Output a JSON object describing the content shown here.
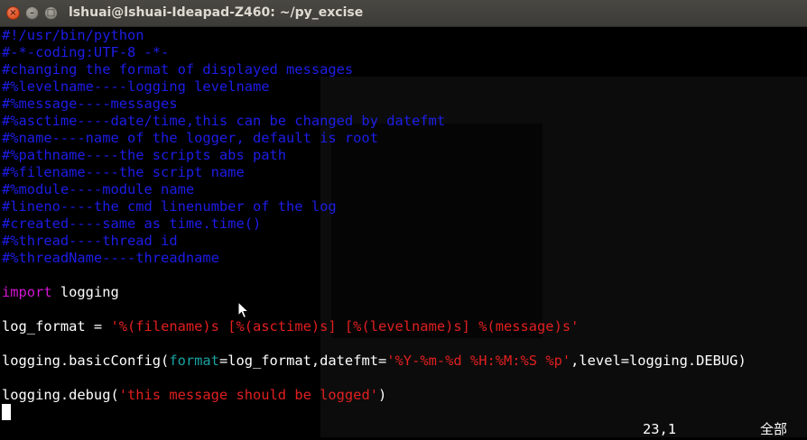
{
  "window": {
    "title": "lshuai@lshuai-Ideapad-Z460: ~/py_excise",
    "buttons": {
      "close": "×",
      "minimize": "–",
      "maximize": "□"
    }
  },
  "editor": {
    "lines": [
      [
        {
          "t": "#!/usr/bin/python",
          "c": "comment"
        }
      ],
      [
        {
          "t": "#-*-coding:UTF-8 -*-",
          "c": "comment"
        }
      ],
      [
        {
          "t": "#changing the format of displayed messages",
          "c": "comment"
        }
      ],
      [
        {
          "t": "#%levelname----logging levelname",
          "c": "comment"
        }
      ],
      [
        {
          "t": "#%message----messages",
          "c": "comment"
        }
      ],
      [
        {
          "t": "#%asctime----date/time,this can be changed by datefmt",
          "c": "comment"
        }
      ],
      [
        {
          "t": "#%name----name of the logger, default is root",
          "c": "comment"
        }
      ],
      [
        {
          "t": "#%pathname----the scripts abs path",
          "c": "comment"
        }
      ],
      [
        {
          "t": "#%filename----the script name",
          "c": "comment"
        }
      ],
      [
        {
          "t": "#%module----module name",
          "c": "comment"
        }
      ],
      [
        {
          "t": "#lineno----the cmd linenumber of the log",
          "c": "comment"
        }
      ],
      [
        {
          "t": "#created----same as time.time()",
          "c": "comment"
        }
      ],
      [
        {
          "t": "#%thread----thread id",
          "c": "comment"
        }
      ],
      [
        {
          "t": "#%threadName----threadname",
          "c": "comment"
        }
      ],
      [],
      [
        {
          "t": "import",
          "c": "kw"
        },
        {
          "t": " logging",
          "c": "plain"
        }
      ],
      [],
      [
        {
          "t": "log_format = ",
          "c": "plain"
        },
        {
          "t": "'%(filename)s [%(asctime)s] [%(levelname)s] %(message)s'",
          "c": "str"
        }
      ],
      [],
      [
        {
          "t": "logging.basicConfig(",
          "c": "plain"
        },
        {
          "t": "format",
          "c": "kwarg"
        },
        {
          "t": "=log_format,datefmt=",
          "c": "plain"
        },
        {
          "t": "'%Y-%m-%d %H:%M:%S %p'",
          "c": "str"
        },
        {
          "t": ",level=logging.DEBUG)",
          "c": "plain"
        }
      ],
      [],
      [
        {
          "t": "logging.debug(",
          "c": "plain"
        },
        {
          "t": "'this message should be logged'",
          "c": "str"
        },
        {
          "t": ")",
          "c": "plain"
        }
      ]
    ]
  },
  "status": {
    "position": "23,1",
    "scroll": "全部"
  },
  "colors": {
    "comment": "#1d1de8",
    "keyword": "#d316d3",
    "string": "#e21f1f",
    "kwarg": "#1aa3a3",
    "text": "#ffffff",
    "background": "#000000"
  }
}
